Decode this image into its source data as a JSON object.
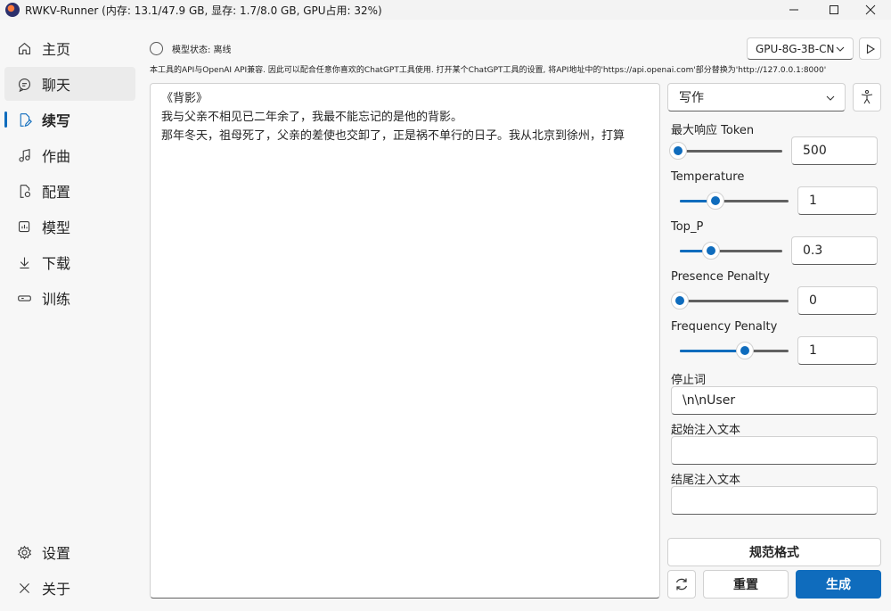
{
  "window": {
    "title": "RWKV-Runner (内存: 13.1/47.9 GB, 显存: 1.7/8.0 GB, GPU占用: 32%)"
  },
  "sidebar": {
    "items": [
      {
        "label": "主页",
        "icon": "home-icon"
      },
      {
        "label": "聊天",
        "icon": "chat-icon"
      },
      {
        "label": "续写",
        "icon": "document-edit-icon"
      },
      {
        "label": "作曲",
        "icon": "music-note-icon"
      },
      {
        "label": "配置",
        "icon": "document-settings-icon"
      },
      {
        "label": "模型",
        "icon": "model-data-icon"
      },
      {
        "label": "下载",
        "icon": "download-icon"
      },
      {
        "label": "训练",
        "icon": "train-icon"
      }
    ],
    "bottom": [
      {
        "label": "设置",
        "icon": "gear-icon"
      },
      {
        "label": "关于",
        "icon": "info-icon"
      }
    ]
  },
  "status": {
    "text": "模型状态: 离线"
  },
  "notice": "本工具的API与OpenAI API兼容. 因此可以配合任意你喜欢的ChatGPT工具使用. 打开某个ChatGPT工具的设置, 将API地址中的'https://api.openai.com'部分替换为'http://127.0.0.1:8000'",
  "model_selector": {
    "value": "GPU-8G-3B-CN"
  },
  "editor": {
    "content": "《背影》\n我与父亲不相见已二年余了，我最不能忘记的是他的背影。\n那年冬天，祖母死了，父亲的差使也交卸了，正是祸不单行的日子。我从北京到徐州，打算"
  },
  "panel": {
    "mode": "写作",
    "params": [
      {
        "label": "最大响应 Token",
        "value": "500",
        "fraction": 0.02
      },
      {
        "label": "Temperature",
        "value": "1",
        "fraction": 0.33
      },
      {
        "label": "Top_P",
        "value": "0.3",
        "fraction": 0.3
      },
      {
        "label": "Presence Penalty",
        "value": "0",
        "fraction": 0.0
      },
      {
        "label": "Frequency Penalty",
        "value": "1",
        "fraction": 0.6
      }
    ],
    "stop_label": "停止词",
    "stop_value": "\\n\\nUser",
    "start_label": "起始注入文本",
    "start_value": "",
    "end_label": "结尾注入文本",
    "end_value": "",
    "format_button": "规范格式",
    "reset_button": "重置",
    "generate_button": "生成"
  },
  "colors": {
    "accent": "#0f6cbd"
  }
}
